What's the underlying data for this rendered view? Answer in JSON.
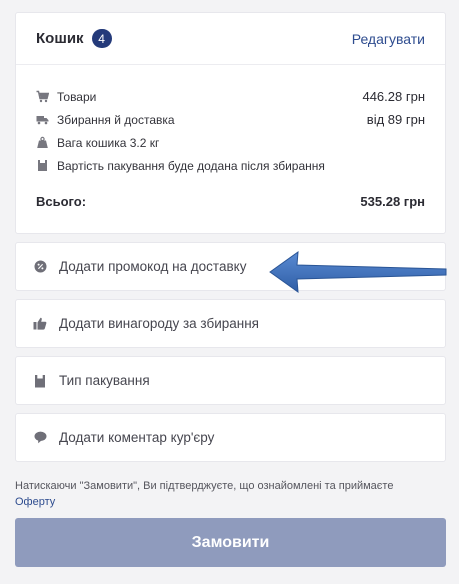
{
  "cart": {
    "title": "Кошик",
    "count": "4",
    "edit_label": "Редагувати",
    "rows": [
      {
        "icon": "cart-icon",
        "label": "Товари",
        "value": "446.28 грн"
      },
      {
        "icon": "delivery-truck-icon",
        "label": "Збирання й доставка",
        "value": "від 89 грн"
      },
      {
        "icon": "weight-icon",
        "label": "Вага кошика 3.2 кг",
        "value": ""
      },
      {
        "icon": "package-icon",
        "label": "Вартість пакування буде додана після збирання",
        "value": ""
      }
    ],
    "total_label": "Всього:",
    "total_value": "535.28 грн"
  },
  "options": [
    {
      "icon": "promo-percent-icon",
      "label": "Додати промокод на доставку"
    },
    {
      "icon": "thumbs-up-icon",
      "label": "Додати винагороду за збирання"
    },
    {
      "icon": "bag-icon",
      "label": "Тип пакування"
    },
    {
      "icon": "comment-icon",
      "label": "Додати коментар кур'єру"
    }
  ],
  "disclaimer": {
    "text": "Натискаючи \"Замовити\", Ви підтверджуєте, що ознайомлені та приймаєте",
    "link": "Оферту"
  },
  "order_button": "Замовити",
  "colors": {
    "accent": "#243a7a",
    "link": "#2e4c8f",
    "button": "#8f9bbd",
    "arrow": "#3d6fba"
  }
}
